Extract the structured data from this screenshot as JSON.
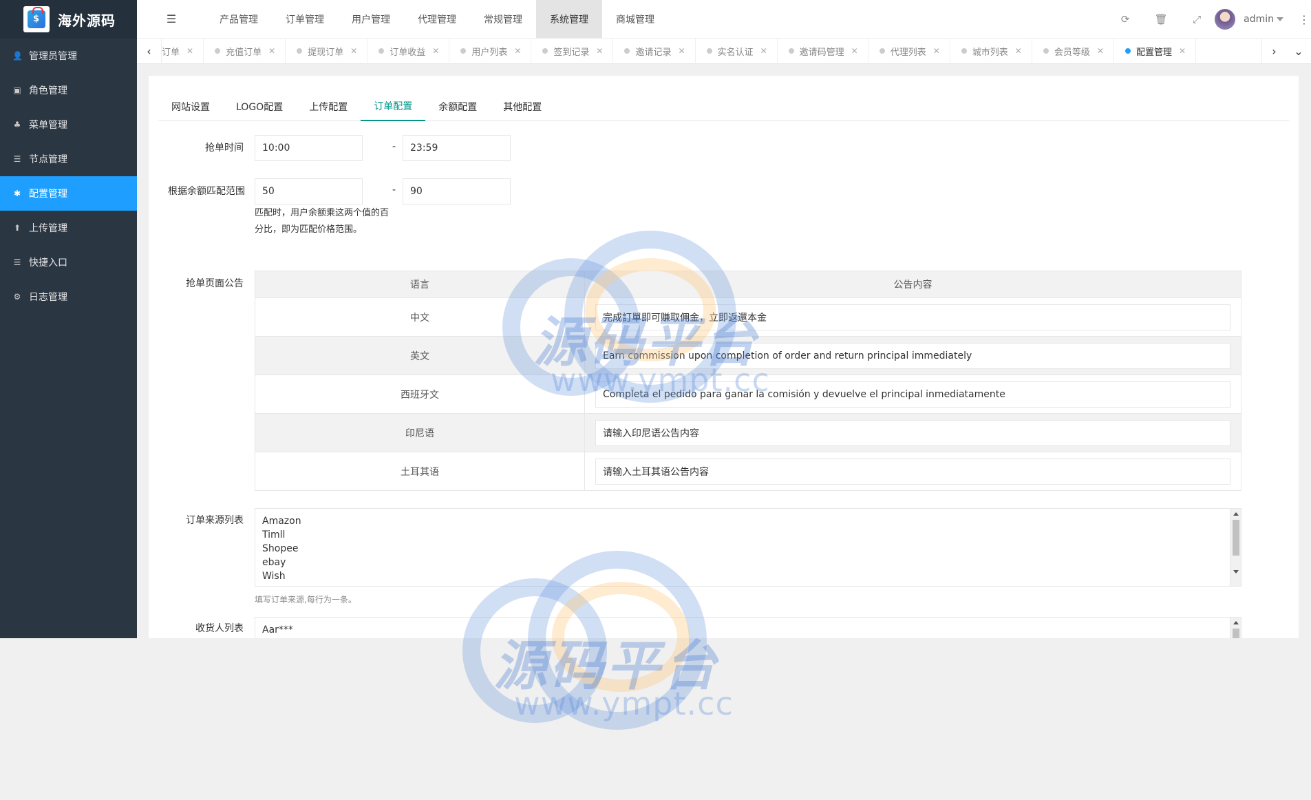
{
  "app": {
    "logo_text": "海外源码"
  },
  "sidebar": {
    "items": [
      {
        "label": "管理员管理",
        "icon": "user-icon",
        "glyph": "👤"
      },
      {
        "label": "角色管理",
        "icon": "role-icon",
        "glyph": "▣"
      },
      {
        "label": "菜单管理",
        "icon": "tree-icon",
        "glyph": "♣"
      },
      {
        "label": "节点管理",
        "icon": "list-icon",
        "glyph": "☰"
      },
      {
        "label": "配置管理",
        "icon": "gear-icon",
        "glyph": "✱",
        "active": true
      },
      {
        "label": "上传管理",
        "icon": "upload-icon",
        "glyph": "⬆"
      },
      {
        "label": "快捷入口",
        "icon": "list-icon",
        "glyph": "☰"
      },
      {
        "label": "日志管理",
        "icon": "log-icon",
        "glyph": "⚙"
      }
    ]
  },
  "header": {
    "menu": [
      {
        "label": "产品管理"
      },
      {
        "label": "订单管理"
      },
      {
        "label": "用户管理"
      },
      {
        "label": "代理管理"
      },
      {
        "label": "常规管理"
      },
      {
        "label": "系统管理",
        "active": true
      },
      {
        "label": "商城管理"
      }
    ],
    "user": "admin"
  },
  "tabs": [
    {
      "label": "订单",
      "partial": true
    },
    {
      "label": "充值订单"
    },
    {
      "label": "提现订单"
    },
    {
      "label": "订单收益"
    },
    {
      "label": "用户列表"
    },
    {
      "label": "签到记录"
    },
    {
      "label": "邀请记录"
    },
    {
      "label": "实名认证"
    },
    {
      "label": "邀请码管理"
    },
    {
      "label": "代理列表"
    },
    {
      "label": "城市列表"
    },
    {
      "label": "会员等级"
    },
    {
      "label": "配置管理",
      "active": true
    }
  ],
  "config_tabs": [
    {
      "label": "网站设置"
    },
    {
      "label": "LOGO配置"
    },
    {
      "label": "上传配置"
    },
    {
      "label": "订单配置",
      "active": true
    },
    {
      "label": "余额配置"
    },
    {
      "label": "其他配置"
    }
  ],
  "form": {
    "grab_time": {
      "label": "抢单时间",
      "start": "10:00",
      "sep": "-",
      "end": "23:59"
    },
    "balance_range": {
      "label": "根据余额匹配范围",
      "min": "50",
      "sep": "-",
      "max": "90",
      "hint": "匹配时，用户余额乘这两个值的百分比，即为匹配价格范围。"
    },
    "notice": {
      "label": "抢单页面公告",
      "col_lang": "语言",
      "col_content": "公告内容",
      "rows": [
        {
          "lang": "中文",
          "value": "完成訂單即可賺取佣金，立即返還本金",
          "placeholder": ""
        },
        {
          "lang": "英文",
          "value": "Earn commission upon completion of order and return principal immediately",
          "placeholder": ""
        },
        {
          "lang": "西班牙文",
          "value": "Completa el pedido para ganar la comisión y devuelve el principal inmediatamente",
          "placeholder": ""
        },
        {
          "lang": "印尼语",
          "value": "",
          "placeholder": "请输入印尼语公告内容"
        },
        {
          "lang": "土耳其语",
          "value": "",
          "placeholder": "请输入土耳其语公告内容"
        }
      ]
    },
    "order_sources": {
      "label": "订单来源列表",
      "lines": [
        "Amazon",
        "Timll",
        "Shopee",
        "ebay",
        "Wish"
      ],
      "hint": "填写订单来源,每行为一条。"
    },
    "receivers": {
      "label": "收货人列表",
      "lines": [
        "Aar***"
      ]
    }
  },
  "watermark": {
    "text": "源码平台",
    "url": "www.ympt.cc"
  }
}
